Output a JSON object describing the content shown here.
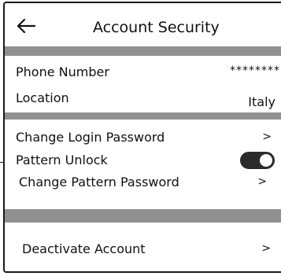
{
  "header": {
    "title": "Account Security",
    "back_icon": "back-arrow-icon"
  },
  "info": {
    "phone": {
      "label": "Phone Number",
      "value": "********"
    },
    "location": {
      "label": "Location",
      "value": "Italy"
    }
  },
  "security": {
    "change_login_password": {
      "label": "Change Login Password",
      "chevron": ">"
    },
    "pattern_unlock": {
      "label": "Pattern Unlock",
      "toggle_on": true
    },
    "change_pattern_password": {
      "label": "Change Pattern Password",
      "chevron": ">"
    }
  },
  "account": {
    "deactivate": {
      "label": "Deactivate Account",
      "chevron": ">"
    }
  },
  "colors": {
    "divider": "#909090",
    "toggle": "#2b2b2b"
  }
}
